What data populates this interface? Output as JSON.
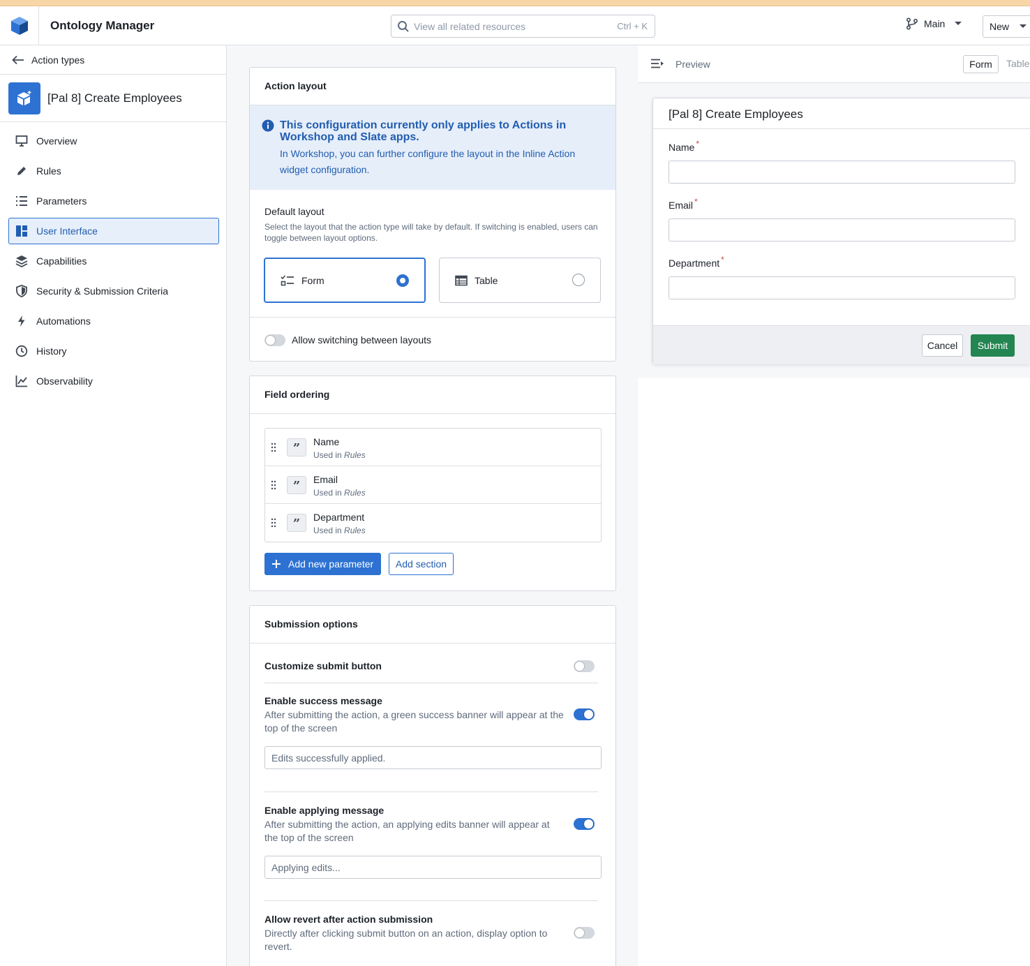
{
  "app": {
    "title": "Ontology Manager",
    "logo_icon": "cube-logo-icon"
  },
  "search": {
    "placeholder": "View all related resources",
    "shortcut": "Ctrl + K"
  },
  "branch": {
    "label": "Main"
  },
  "new_button": {
    "label": "New"
  },
  "sidebar": {
    "back_label": "Action types",
    "entity_title": "[Pal 8] Create Employees",
    "items": [
      {
        "label": "Overview",
        "icon": "desktop-icon"
      },
      {
        "label": "Rules",
        "icon": "pencil-icon"
      },
      {
        "label": "Parameters",
        "icon": "list-icon"
      },
      {
        "label": "User Interface",
        "icon": "layout-icon",
        "active": true
      },
      {
        "label": "Capabilities",
        "icon": "layers-icon"
      },
      {
        "label": "Security & Submission Criteria",
        "icon": "shield-icon"
      },
      {
        "label": "Automations",
        "icon": "lightning-icon"
      },
      {
        "label": "History",
        "icon": "clock-icon"
      },
      {
        "label": "Observability",
        "icon": "chart-icon"
      }
    ]
  },
  "action_layout": {
    "title": "Action layout",
    "callout_title": "This configuration currently only applies to Actions in Workshop and Slate apps.",
    "callout_body": "In Workshop, you can further configure the layout in the Inline Action widget configuration.",
    "default_layout_label": "Default layout",
    "default_layout_desc": "Select the layout that the action type will take by default. If switching is enabled, users can toggle between layout options.",
    "options": [
      {
        "label": "Form",
        "selected": true
      },
      {
        "label": "Table",
        "selected": false
      }
    ],
    "switch_label": "Allow switching between layouts",
    "switch_on": false
  },
  "field_ordering": {
    "title": "Field ordering",
    "used_in_prefix": "Used in",
    "used_in_target": "Rules",
    "fields": [
      {
        "name": "Name"
      },
      {
        "name": "Email"
      },
      {
        "name": "Department"
      }
    ],
    "add_parameter_label": "Add new parameter",
    "add_section_label": "Add section"
  },
  "submission": {
    "title": "Submission options",
    "customize_label": "Customize submit button",
    "customize_on": false,
    "success_title": "Enable success message",
    "success_desc": "After submitting the action, a green success banner will appear at the top of the screen",
    "success_on": true,
    "success_value": "Edits successfully applied.",
    "applying_title": "Enable applying message",
    "applying_desc": "After submitting the action, an applying edits banner will appear at the top of the screen",
    "applying_on": true,
    "applying_value": "Applying edits...",
    "revert_title": "Allow revert after action submission",
    "revert_desc": "Directly after clicking submit button on an action, display option to revert.",
    "revert_on": false
  },
  "preview": {
    "label": "Preview",
    "tab_form": "Form",
    "tab_table": "Table",
    "form_title": "[Pal 8] Create Employees",
    "fields": [
      {
        "label": "Name",
        "required_mark": "*"
      },
      {
        "label": "Email",
        "required_mark": "*"
      },
      {
        "label": "Department",
        "required_mark": "*"
      }
    ],
    "cancel_label": "Cancel",
    "submit_label": "Submit"
  },
  "colors": {
    "accent": "#2d72d2",
    "submit": "#238551",
    "callout_bg": "#e6eef9",
    "required": "#cd4246"
  }
}
